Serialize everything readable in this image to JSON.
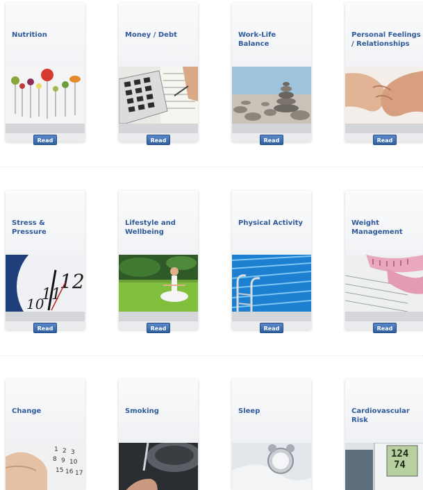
{
  "rows": [
    {
      "cards": [
        {
          "title": "Nutrition",
          "button": "Read",
          "image": "vegetables-on-forks"
        },
        {
          "title": "Money / Debt",
          "button": "Read",
          "image": "calculator-and-paper"
        },
        {
          "title": "Work-Life Balance",
          "button": "Read",
          "image": "stacked-stones"
        },
        {
          "title": "Personal Feelings / Relationships",
          "button": "Read",
          "image": "holding-hands"
        }
      ]
    },
    {
      "cards": [
        {
          "title": "Stress & Pressure",
          "button": "Read",
          "image": "clock-face"
        },
        {
          "title": "Lifestyle and Wellbeing",
          "button": "Read",
          "image": "yoga-on-grass"
        },
        {
          "title": "Physical Activity",
          "button": "Read",
          "image": "swimming-pool"
        },
        {
          "title": "Weight Management",
          "button": "Read",
          "image": "measuring-tape"
        }
      ]
    },
    {
      "cards": [
        {
          "title": "Change",
          "button": "",
          "image": "calendar-hand"
        },
        {
          "title": "Smoking",
          "button": "",
          "image": "cigarette"
        },
        {
          "title": "Sleep",
          "button": "",
          "image": "alarm-clock"
        },
        {
          "title": "Cardiovascular Risk",
          "button": "",
          "image": "blood-pressure-monitor"
        }
      ]
    }
  ]
}
